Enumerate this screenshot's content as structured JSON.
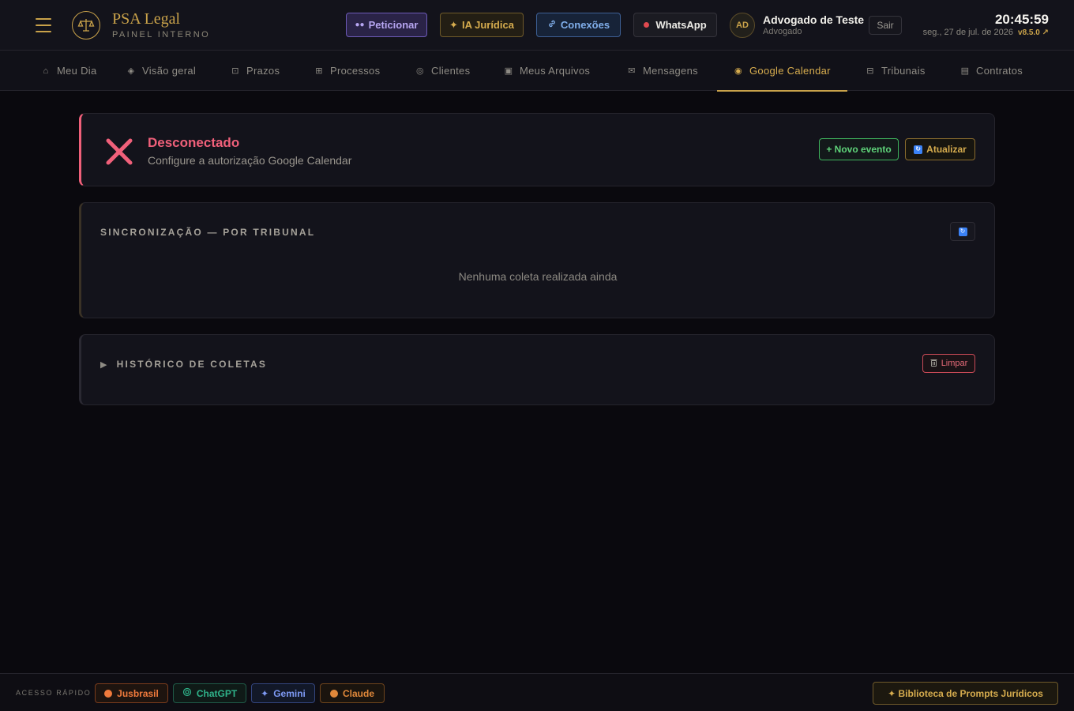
{
  "app": {
    "brand_title": "PSA Legal",
    "brand_subtitle": "PAINEL INTERNO"
  },
  "header": {
    "buttons": {
      "peticionar": "Peticionar",
      "ia": "IA Jurídica",
      "conexoes": "Conexões",
      "whatsapp": "WhatsApp"
    },
    "user": {
      "initials": "AD",
      "name": "Advogado de Teste",
      "role": "Advogado"
    },
    "logout_label": "Sair",
    "clock": "20:45:59",
    "date": "seg., 27 de jul. de 2026",
    "version": "v8.5.0 ↗"
  },
  "tabs": [
    {
      "label": "Meu Dia",
      "icon": "⌂"
    },
    {
      "label": "Visão geral",
      "icon": "◈"
    },
    {
      "label": "Prazos",
      "icon": "⊡"
    },
    {
      "label": "Processos",
      "icon": "⊞"
    },
    {
      "label": "Clientes",
      "icon": "◎"
    },
    {
      "label": "Meus Arquivos",
      "icon": "▣"
    },
    {
      "label": "Mensagens",
      "icon": "✉"
    },
    {
      "label": "Google Calendar",
      "icon": "◉",
      "active": true
    },
    {
      "label": "Tribunais",
      "icon": "⊟"
    },
    {
      "label": "Contratos",
      "icon": "▤"
    }
  ],
  "status": {
    "title": "Desconectado",
    "subtitle": "Configure a autorização Google Calendar",
    "new_event": "+ Novo evento",
    "refresh": "Atualizar"
  },
  "sync": {
    "title": "SINCRONIZAÇÃO — POR TRIBUNAL",
    "empty": "Nenhuma coleta realizada ainda"
  },
  "history": {
    "title": "HISTÓRICO DE COLETAS",
    "clear": "Limpar"
  },
  "footer": {
    "quick_label": "ACESSO RÁPIDO",
    "links": {
      "jusbrasil": "Jusbrasil",
      "chatgpt": "ChatGPT",
      "gemini": "Gemini",
      "claude": "Claude"
    },
    "library": "✦ Biblioteca de Prompts Jurídicos"
  },
  "colors": {
    "accent_gold": "#c9a24a",
    "danger": "#f0607a",
    "success": "#5fd47a"
  }
}
